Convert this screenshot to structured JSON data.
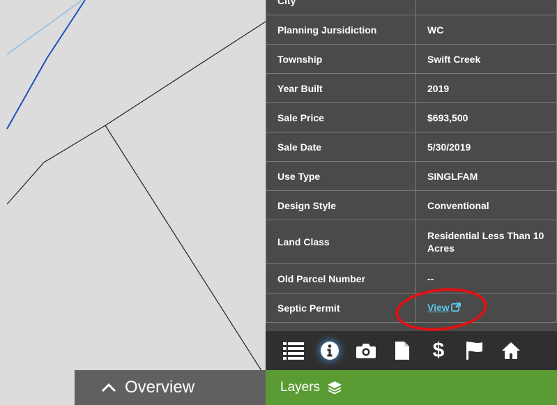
{
  "parcel_table": {
    "rows": [
      {
        "label": "City",
        "value": ""
      },
      {
        "label": "Planning Jursidiction",
        "value": "WC"
      },
      {
        "label": "Township",
        "value": "Swift Creek"
      },
      {
        "label": "Year Built",
        "value": "2019"
      },
      {
        "label": "Sale Price",
        "value": "$693,500"
      },
      {
        "label": "Sale Date",
        "value": "5/30/2019"
      },
      {
        "label": "Use Type",
        "value": "SINGLFAM"
      },
      {
        "label": "Design Style",
        "value": "Conventional"
      },
      {
        "label": "Land Class",
        "value": "Residential Less Than 10 Acres"
      },
      {
        "label": "Old Parcel Number",
        "value": "--"
      },
      {
        "label": "Septic Permit",
        "value": "View"
      }
    ]
  },
  "toolbar": {
    "items": [
      {
        "name": "list-icon",
        "active": false
      },
      {
        "name": "info-icon",
        "active": true
      },
      {
        "name": "camera-icon",
        "active": false
      },
      {
        "name": "document-icon",
        "active": false
      },
      {
        "name": "dollar-icon",
        "glyph": "$",
        "active": false
      },
      {
        "name": "flag-icon",
        "active": false
      },
      {
        "name": "home-icon",
        "active": false
      }
    ]
  },
  "bottom_tabs": {
    "overview_label": "Overview",
    "layers_label": "Layers"
  },
  "colors": {
    "panel_bg": "#4a4a4a",
    "toolbar_bg": "#2f2f2f",
    "overview_tab_bg": "#606060",
    "layers_tab_bg": "#5b9b34",
    "link": "#5bc6e8",
    "annotation": "#e21111",
    "map_bg": "#dcdcdc"
  }
}
